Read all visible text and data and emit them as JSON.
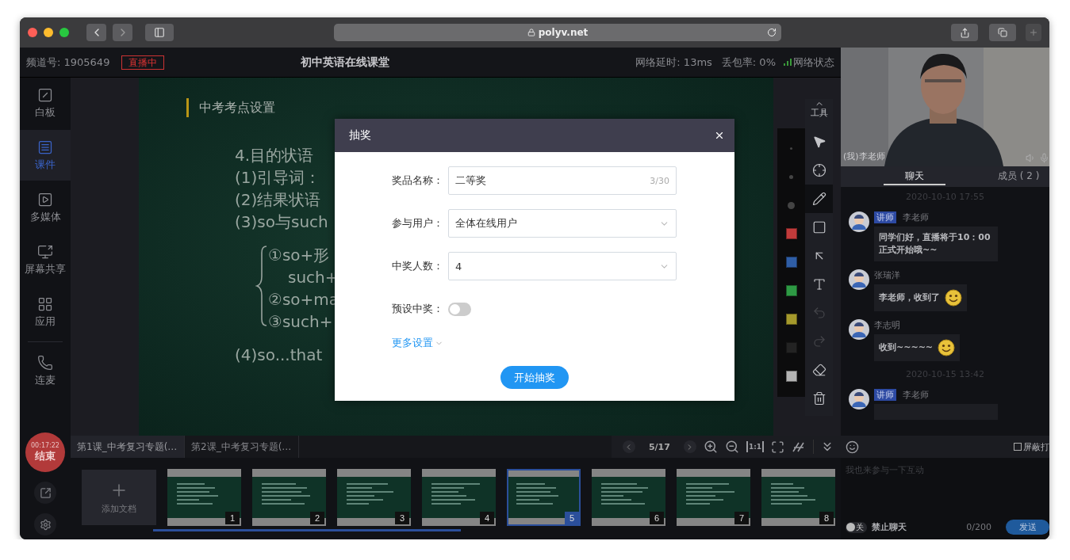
{
  "browser": {
    "url": "polyv.net"
  },
  "header": {
    "channel": "频道号: 1905649",
    "live_badge": "直播中",
    "title": "初中英语在线课堂",
    "latency": "网络延时: 13ms",
    "packet_loss": "丢包率: 0%",
    "network": "网络状态"
  },
  "sidebar": {
    "items": [
      {
        "kind": "whiteboard",
        "label": "白板",
        "selected": false
      },
      {
        "kind": "courseware",
        "label": "课件",
        "selected": true
      },
      {
        "kind": "media",
        "label": "多媒体",
        "selected": false
      },
      {
        "kind": "screen",
        "label": "屏幕共享",
        "selected": false
      },
      {
        "kind": "apps",
        "label": "应用",
        "selected": false
      },
      {
        "kind": "call",
        "label": "连麦",
        "selected": false
      }
    ],
    "timer": "00:17:22",
    "end_button": "结束"
  },
  "slide": {
    "heading": "中考考点设置",
    "lines": [
      {
        "kind": "title",
        "text": "4.目的状语"
      },
      {
        "kind": "line",
        "text": "(1)引导词："
      },
      {
        "kind": "line",
        "text": "(2)结果状语"
      },
      {
        "kind": "line",
        "text": "(3)so与such"
      },
      {
        "kind": "brace",
        "text": "①so+形"
      },
      {
        "kind": "brace_cont",
        "text": "such+"
      },
      {
        "kind": "brace",
        "text": "②so+ma"
      },
      {
        "kind": "brace",
        "text": "③such+"
      },
      {
        "kind": "gap_line",
        "text": "(4)so...that"
      }
    ]
  },
  "tools": {
    "label": "工具",
    "colors": [
      {
        "color": "#c23b3b"
      },
      {
        "color": "#2f5ea6"
      },
      {
        "color": "#2e9a44"
      },
      {
        "color": "#a59a2c"
      },
      {
        "color": "#232323"
      },
      {
        "color": "#b4b4b4"
      }
    ],
    "items": [
      {
        "kind": "select",
        "selected": false,
        "disabled": false
      },
      {
        "kind": "laser",
        "selected": false,
        "disabled": false
      },
      {
        "kind": "pencil",
        "selected": true,
        "disabled": false
      },
      {
        "kind": "rect",
        "selected": false,
        "disabled": false
      },
      {
        "kind": "arrow",
        "selected": false,
        "disabled": false
      },
      {
        "kind": "text",
        "selected": false,
        "disabled": false
      },
      {
        "kind": "undo",
        "selected": false,
        "disabled": true
      },
      {
        "kind": "redo",
        "selected": false,
        "disabled": true
      },
      {
        "kind": "eraser",
        "selected": false,
        "disabled": false
      },
      {
        "kind": "trash",
        "selected": false,
        "disabled": false
      }
    ]
  },
  "dialog": {
    "title": "抽奖",
    "fields": [
      {
        "kind": "text",
        "label": "奖品名称：",
        "value": "二等奖",
        "counter": "3/30"
      },
      {
        "kind": "select",
        "label": "参与用户：",
        "value": "全体在线用户"
      },
      {
        "kind": "select",
        "label": "中奖人数：",
        "value": "4"
      },
      {
        "kind": "switch",
        "label": "预设中奖：",
        "on": false
      }
    ],
    "more_link": "更多设置",
    "submit": "开始抽奖"
  },
  "doc_tabs": [
    {
      "label": "第1课_中考复习专题(…",
      "selected": true
    },
    {
      "label": "第2课_中考复习专题(…",
      "selected": false
    }
  ],
  "pager": {
    "page": "5/17",
    "actual_size": "1:1"
  },
  "add_document": "添加文档",
  "thumbnails": [
    {
      "number": "1",
      "selected": false
    },
    {
      "number": "2",
      "selected": false
    },
    {
      "number": "3",
      "selected": false
    },
    {
      "number": "4",
      "selected": false
    },
    {
      "number": "5",
      "selected": true
    },
    {
      "number": "6",
      "selected": false
    },
    {
      "number": "7",
      "selected": false
    },
    {
      "number": "8",
      "selected": false
    }
  ],
  "video": {
    "caption": "(我)李老师"
  },
  "chat_tabs": [
    {
      "label": "聊天",
      "selected": true
    },
    {
      "label": "成员 ( 2 )",
      "selected": false
    }
  ],
  "chat": [
    {
      "kind": "time",
      "text": "2020-10-10 17:55"
    },
    {
      "kind": "message",
      "badge": "讲师",
      "name": "李老师",
      "text": "同学们好，直播将于10：00正式开始哦~~",
      "emoji": false
    },
    {
      "kind": "message",
      "name": "张瑞洋",
      "text": "李老师，收到了",
      "emoji": true
    },
    {
      "kind": "message",
      "name": "李志明",
      "text": "收到~~~~~",
      "emoji": true
    },
    {
      "kind": "time",
      "text": "2020-10-15 13:42"
    },
    {
      "kind": "message",
      "badge": "讲师",
      "name": "李老师",
      "emoji": false
    }
  ],
  "chat_input": {
    "block_gifts": {
      "label": "屏蔽打",
      "checked": false
    },
    "placeholder": "我也来参与一下互动",
    "ban": {
      "state": "关",
      "label": "禁止聊天",
      "on": false
    },
    "counter": "0/200",
    "send": "发送"
  }
}
